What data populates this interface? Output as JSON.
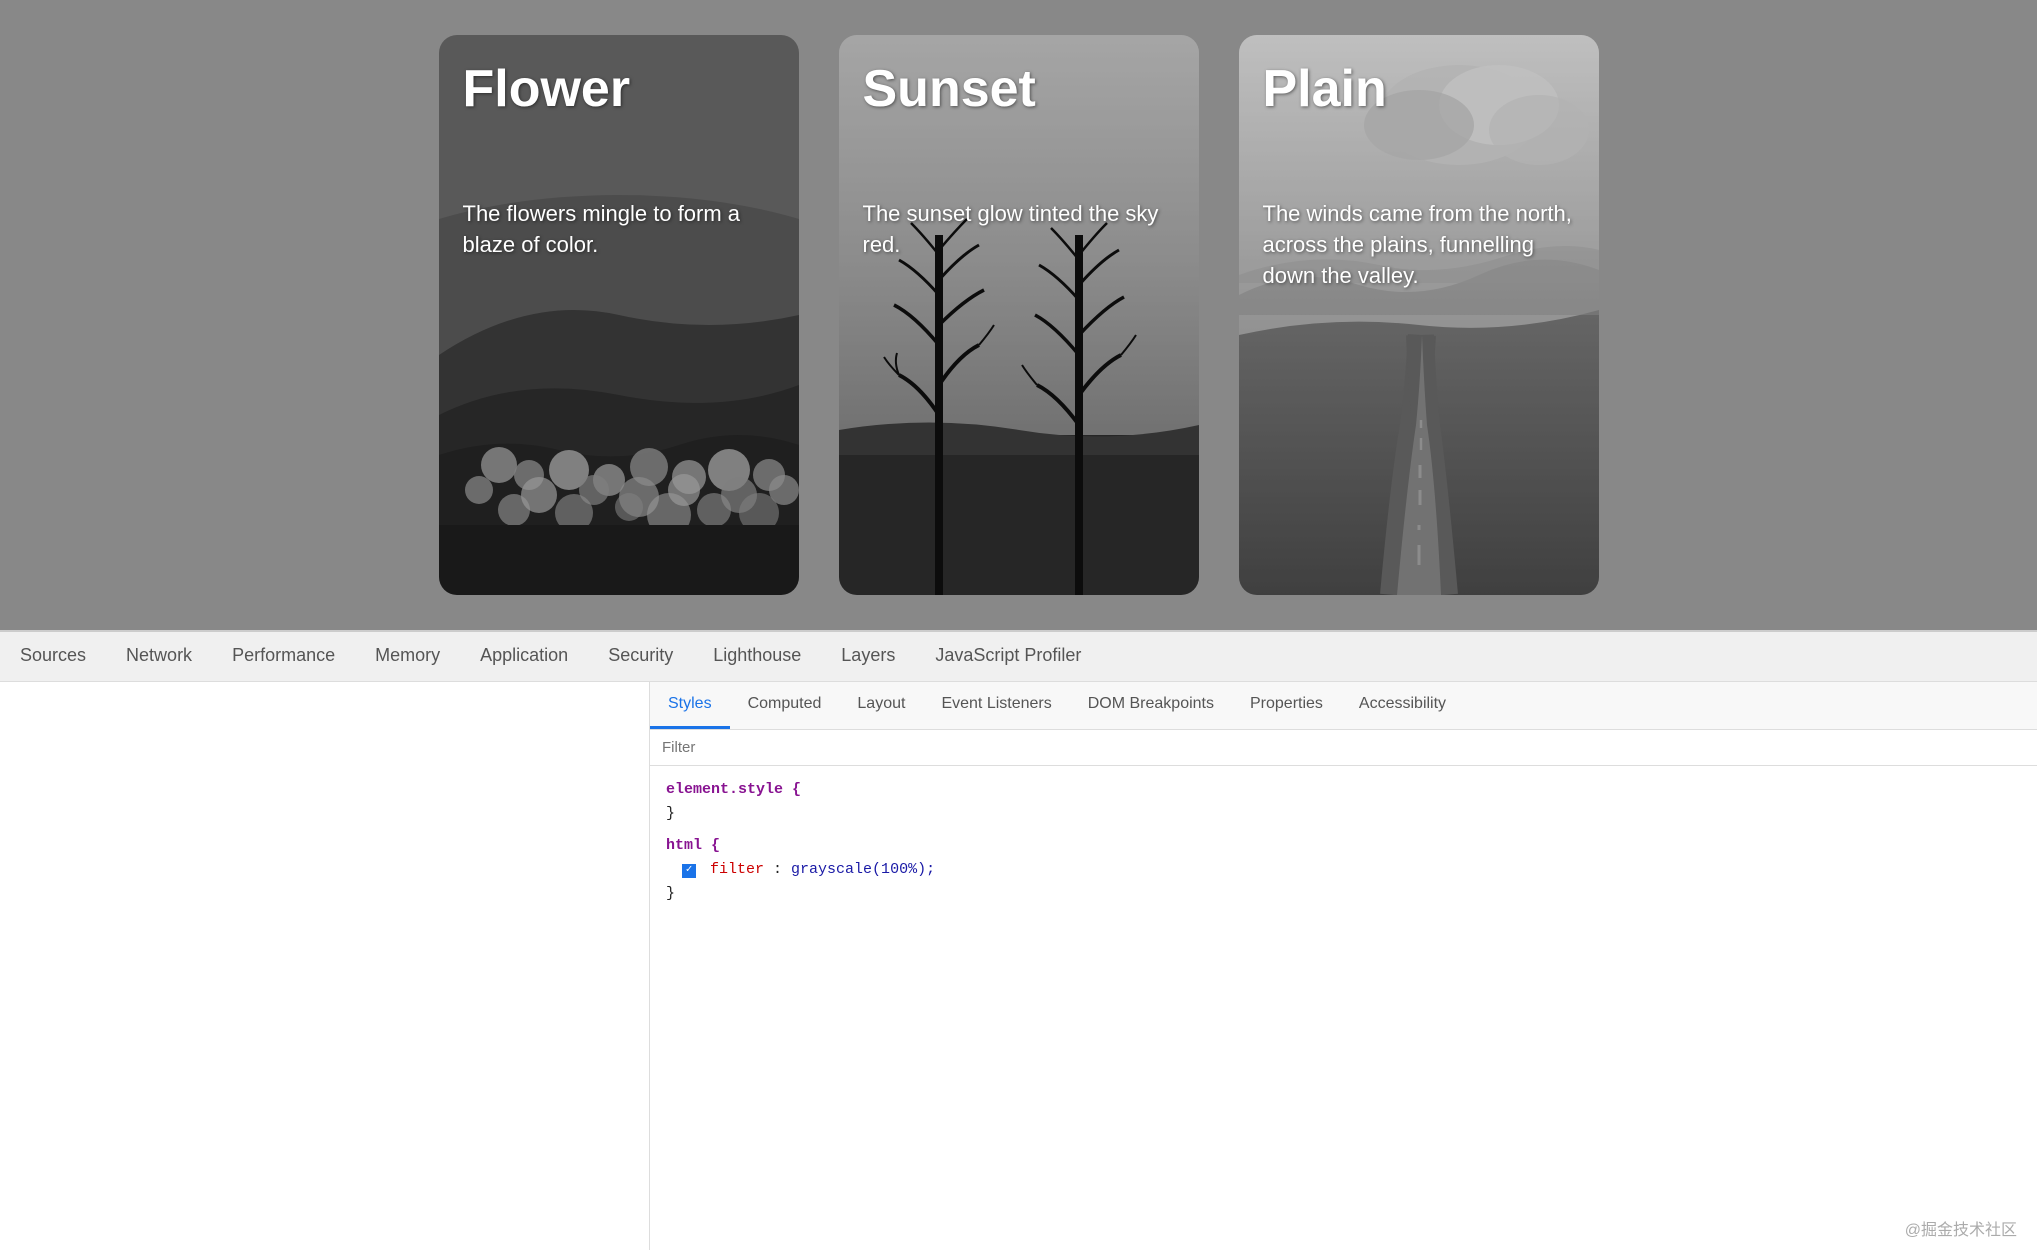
{
  "cards": [
    {
      "id": "flower",
      "title": "Flower",
      "description": "The flowers mingle to form a blaze of color.",
      "bgClass": "bg-flower"
    },
    {
      "id": "sunset",
      "title": "Sunset",
      "description": "The sunset glow tinted the sky red.",
      "bgClass": "bg-sunset"
    },
    {
      "id": "plain",
      "title": "Plain",
      "description": "The winds came from the north, across the plains, funnelling down the valley.",
      "bgClass": "bg-plain"
    }
  ],
  "devtools": {
    "main_tabs": [
      {
        "id": "sources",
        "label": "Sources"
      },
      {
        "id": "network",
        "label": "Network"
      },
      {
        "id": "performance",
        "label": "Performance"
      },
      {
        "id": "memory",
        "label": "Memory"
      },
      {
        "id": "application",
        "label": "Application"
      },
      {
        "id": "security",
        "label": "Security"
      },
      {
        "id": "lighthouse",
        "label": "Lighthouse"
      },
      {
        "id": "layers",
        "label": "Layers"
      },
      {
        "id": "javascript-profiler",
        "label": "JavaScript Profiler"
      }
    ],
    "styles_tabs": [
      {
        "id": "styles",
        "label": "Styles",
        "active": true
      },
      {
        "id": "computed",
        "label": "Computed"
      },
      {
        "id": "layout",
        "label": "Layout"
      },
      {
        "id": "event-listeners",
        "label": "Event Listeners"
      },
      {
        "id": "dom-breakpoints",
        "label": "DOM Breakpoints"
      },
      {
        "id": "properties",
        "label": "Properties"
      },
      {
        "id": "accessibility",
        "label": "Accessibility"
      }
    ],
    "filter_placeholder": "Filter",
    "code_blocks": [
      {
        "selector": "element.style {",
        "properties": [],
        "close": "}"
      },
      {
        "selector": "html {",
        "properties": [
          {
            "checked": true,
            "name": "filter",
            "value": "grayscale(100%);"
          }
        ],
        "close": "}"
      }
    ],
    "watermark": "@掘金技术社区"
  }
}
